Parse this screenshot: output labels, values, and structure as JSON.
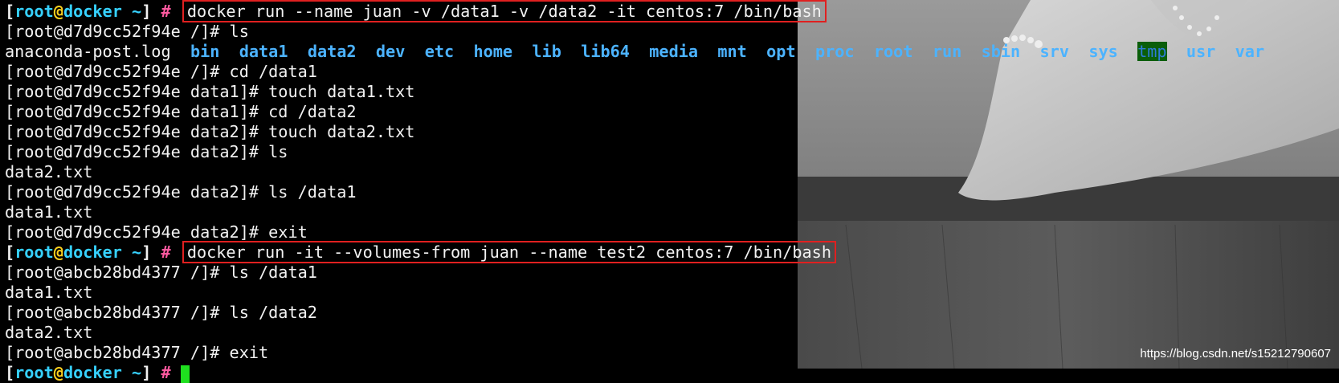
{
  "terminal": {
    "lines": [
      {
        "type": "host_prompt",
        "user": "root",
        "host": "docker",
        "dir": "~",
        "command": "docker run --name juan -v /data1 -v /data2 -it centos:7 /bin/bash"
      },
      {
        "type": "text",
        "text": "[root@d7d9cc52f94e /]# ls"
      },
      {
        "type": "listing",
        "items": [
          {
            "name": "anaconda-post.log",
            "kind": "file"
          },
          {
            "name": "bin",
            "kind": "dir"
          },
          {
            "name": "data1",
            "kind": "dir"
          },
          {
            "name": "data2",
            "kind": "dir"
          },
          {
            "name": "dev",
            "kind": "dir"
          },
          {
            "name": "etc",
            "kind": "dir"
          },
          {
            "name": "home",
            "kind": "dir"
          },
          {
            "name": "lib",
            "kind": "dir"
          },
          {
            "name": "lib64",
            "kind": "dir"
          },
          {
            "name": "media",
            "kind": "dir"
          },
          {
            "name": "mnt",
            "kind": "dir"
          },
          {
            "name": "opt",
            "kind": "dir"
          },
          {
            "name": "proc",
            "kind": "dir"
          },
          {
            "name": "root",
            "kind": "dir"
          },
          {
            "name": "run",
            "kind": "dir"
          },
          {
            "name": "sbin",
            "kind": "dir"
          },
          {
            "name": "srv",
            "kind": "dir"
          },
          {
            "name": "sys",
            "kind": "dir"
          },
          {
            "name": "tmp",
            "kind": "dir-hl"
          },
          {
            "name": "usr",
            "kind": "dir"
          },
          {
            "name": "var",
            "kind": "dir"
          }
        ]
      },
      {
        "type": "text",
        "text": "[root@d7d9cc52f94e /]# cd /data1"
      },
      {
        "type": "text",
        "text": "[root@d7d9cc52f94e data1]# touch data1.txt"
      },
      {
        "type": "text",
        "text": "[root@d7d9cc52f94e data1]# cd /data2"
      },
      {
        "type": "text",
        "text": "[root@d7d9cc52f94e data2]# touch data2.txt"
      },
      {
        "type": "text",
        "text": "[root@d7d9cc52f94e data2]# ls"
      },
      {
        "type": "text",
        "text": "data2.txt"
      },
      {
        "type": "text",
        "text": "[root@d7d9cc52f94e data2]# ls /data1"
      },
      {
        "type": "text",
        "text": "data1.txt"
      },
      {
        "type": "text",
        "text": "[root@d7d9cc52f94e data2]# exit"
      },
      {
        "type": "host_prompt",
        "user": "root",
        "host": "docker",
        "dir": "~",
        "command": "docker run -it --volumes-from juan --name test2 centos:7 /bin/bash"
      },
      {
        "type": "text",
        "text": "[root@abcb28bd4377 /]# ls /data1"
      },
      {
        "type": "text",
        "text": "data1.txt"
      },
      {
        "type": "text",
        "text": "[root@abcb28bd4377 /]# ls /data2"
      },
      {
        "type": "text",
        "text": "data2.txt"
      },
      {
        "type": "text",
        "text": "[root@abcb28bd4377 /]# exit"
      },
      {
        "type": "host_prompt_cursor",
        "user": "root",
        "host": "docker",
        "dir": "~"
      }
    ]
  },
  "watermark": "https://blog.csdn.net/s15212790607",
  "colors": {
    "background": "#000000",
    "text": "#f2f2f2",
    "prompt_user_host": "#36d1ff",
    "prompt_at": "#ffd21e",
    "prompt_hash": "#ff5aa0",
    "directory": "#4cb3ff",
    "highlight_box": "#e02020",
    "cursor": "#1fe01f",
    "tmp_bg": "#0a5e0a"
  },
  "background_image": "grayscale-photo-arm-on-wooden-table"
}
